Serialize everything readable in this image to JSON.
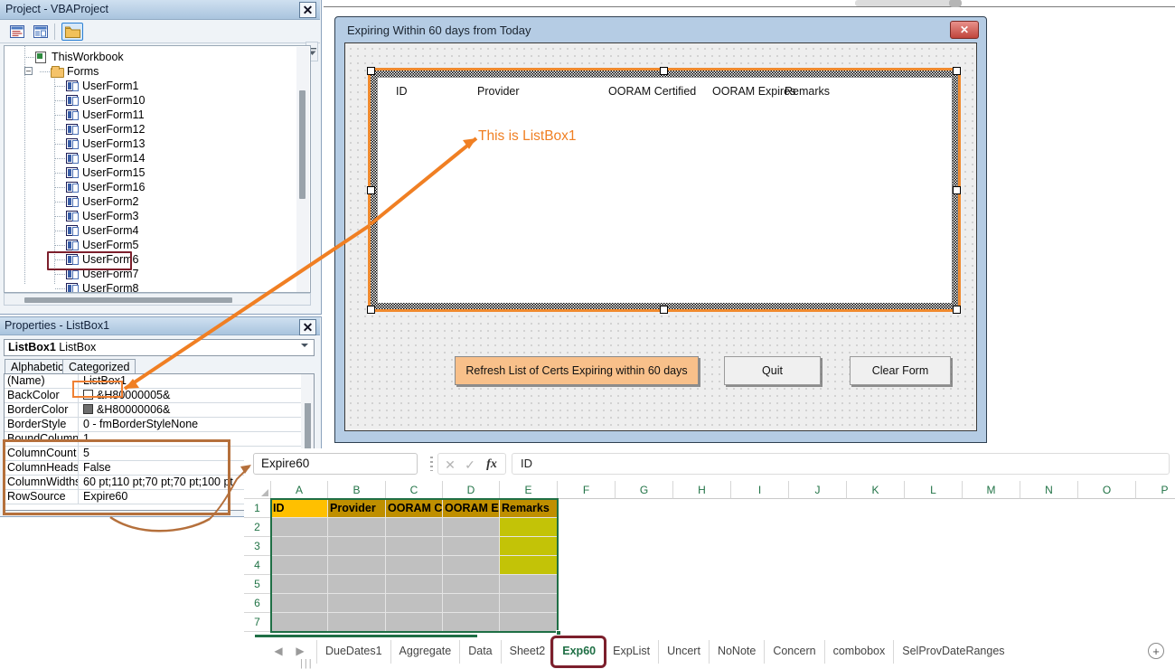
{
  "project_explorer": {
    "title": "Project - VBAProject",
    "close_label": "✕",
    "toolbar": {
      "view_code_icon": "view-code-icon",
      "view_object_icon": "view-object-icon",
      "toggle_folders_icon": "toggle-folders-icon"
    },
    "tree": [
      {
        "label": "ThisWorkbook",
        "icon": "worksheet-icon",
        "indent": 0,
        "kind": "sheet"
      },
      {
        "label": "Forms",
        "icon": "folder-icon",
        "indent": 1,
        "kind": "folder"
      },
      {
        "label": "UserForm1",
        "icon": "userform-icon",
        "indent": 2,
        "kind": "form"
      },
      {
        "label": "UserForm10",
        "icon": "userform-icon",
        "indent": 2,
        "kind": "form"
      },
      {
        "label": "UserForm11",
        "icon": "userform-icon",
        "indent": 2,
        "kind": "form"
      },
      {
        "label": "UserForm12",
        "icon": "userform-icon",
        "indent": 2,
        "kind": "form"
      },
      {
        "label": "UserForm13",
        "icon": "userform-icon",
        "indent": 2,
        "kind": "form"
      },
      {
        "label": "UserForm14",
        "icon": "userform-icon",
        "indent": 2,
        "kind": "form"
      },
      {
        "label": "UserForm15",
        "icon": "userform-icon",
        "indent": 2,
        "kind": "form"
      },
      {
        "label": "UserForm16",
        "icon": "userform-icon",
        "indent": 2,
        "kind": "form"
      },
      {
        "label": "UserForm2",
        "icon": "userform-icon",
        "indent": 2,
        "kind": "form"
      },
      {
        "label": "UserForm3",
        "icon": "userform-icon",
        "indent": 2,
        "kind": "form"
      },
      {
        "label": "UserForm4",
        "icon": "userform-icon",
        "indent": 2,
        "kind": "form"
      },
      {
        "label": "UserForm5",
        "icon": "userform-icon",
        "indent": 2,
        "kind": "form"
      },
      {
        "label": "UserForm6",
        "icon": "userform-icon",
        "indent": 2,
        "kind": "form",
        "highlighted": true
      },
      {
        "label": "UserForm7",
        "icon": "userform-icon",
        "indent": 2,
        "kind": "form"
      },
      {
        "label": "UserForm8",
        "icon": "userform-icon",
        "indent": 2,
        "kind": "form"
      }
    ]
  },
  "properties_window": {
    "title": "Properties - ListBox1",
    "close_label": "✕",
    "object_combo": {
      "name": "ListBox1",
      "type": "ListBox"
    },
    "tabs": [
      {
        "label": "Alphabetic",
        "active": true
      },
      {
        "label": "Categorized",
        "active": false
      }
    ],
    "rows": [
      {
        "name": "(Name)",
        "value": "ListBox1",
        "swatch": ""
      },
      {
        "name": "BackColor",
        "value": "&H80000005&",
        "swatch": "#ffffff"
      },
      {
        "name": "BorderColor",
        "value": "&H80000006&",
        "swatch": "#6e6e6e"
      },
      {
        "name": "BorderStyle",
        "value": "0 - fmBorderStyleNone",
        "swatch": ""
      },
      {
        "name": "BoundColumn",
        "value": "1",
        "swatch": ""
      },
      {
        "name": "ColumnCount",
        "value": "5",
        "swatch": ""
      },
      {
        "name": "ColumnHeads",
        "value": "False",
        "swatch": ""
      },
      {
        "name": "ColumnWidths",
        "value": "60 pt;110 pt;70 pt;70 pt;100 pt",
        "swatch": ""
      },
      {
        "name": "RowSource",
        "value": "Expire60",
        "swatch": ""
      }
    ]
  },
  "userform": {
    "title": "Expiring Within 60 days from Today",
    "close_label": "✕",
    "listbox": {
      "name": "ListBox1",
      "headers": [
        "ID",
        "Provider",
        "OORAM Certified",
        "OORAM Expires",
        "Remarks"
      ]
    },
    "buttons": [
      {
        "label": "Refresh List of Certs Expiring within 60 days",
        "accent": true
      },
      {
        "label": "Quit",
        "accent": false
      },
      {
        "label": "Clear Form",
        "accent": false
      }
    ]
  },
  "annotation": {
    "listbox_callout": "This is ListBox1",
    "callout_color": "#f07f23",
    "highlight_color": "#7c1f2c",
    "brace_color": "#b5703c"
  },
  "excel": {
    "name_box": "Expire60",
    "cancel_icon": "cancel-icon",
    "confirm_icon": "confirm-icon",
    "function_icon": "insert-function-icon",
    "formula_bar": "ID",
    "columns": [
      "A",
      "B",
      "C",
      "D",
      "E",
      "F",
      "G",
      "H",
      "I",
      "J",
      "K",
      "L",
      "M",
      "N",
      "O",
      "P"
    ],
    "rows": [
      "1",
      "2",
      "3",
      "4",
      "5",
      "6",
      "7"
    ],
    "header_row": [
      "ID",
      "Provider",
      "OORAM C",
      "OORAM E",
      "Remarks"
    ],
    "selection_range": "A1:E7",
    "colors": {
      "header_id": "#ffc000",
      "header_rest": "#bf8f00",
      "filled_body": "#c0c0c0",
      "remarks_fill": "#c3c307",
      "selection_border": "#1f6f45",
      "excel_green": "#217346"
    },
    "sheet_tabs": [
      {
        "label": "DueDates1",
        "active": false
      },
      {
        "label": "Aggregate",
        "active": false
      },
      {
        "label": "Data",
        "active": false
      },
      {
        "label": "Sheet2",
        "active": false
      },
      {
        "label": "Exp60",
        "active": true,
        "highlighted": true
      },
      {
        "label": "ExpList",
        "active": false
      },
      {
        "label": "Uncert",
        "active": false
      },
      {
        "label": "NoNote",
        "active": false
      },
      {
        "label": "Concern",
        "active": false
      },
      {
        "label": "combobox",
        "active": false
      },
      {
        "label": "SelProvDateRanges",
        "active": false
      }
    ],
    "add_sheet_label": "+",
    "nav_prev_icon": "chevron-left-icon",
    "nav_next_icon": "chevron-right-icon"
  }
}
